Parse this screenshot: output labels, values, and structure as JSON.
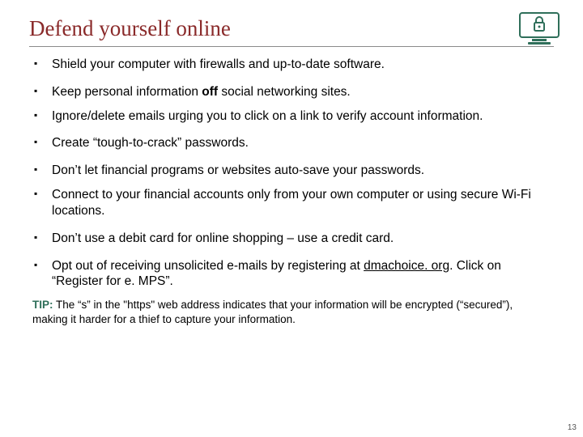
{
  "title": "Defend yourself online",
  "bullets": {
    "b1": "Shield your computer with firewalls and up-to-date software.",
    "b2_pre": "Keep personal information ",
    "b2_bold": "off",
    "b2_post": " social networking sites.",
    "b3": "Ignore/delete emails urging you to click on a link to verify account information.",
    "b4": "Create “tough-to-crack” passwords.",
    "b5": "Don’t let financial programs or websites auto-save your passwords.",
    "b6": "Connect to your financial accounts only from your own computer or using secure Wi-Fi locations.",
    "b7": "Don’t use a debit card for online shopping – use a credit card.",
    "b8_pre": "Opt out of receiving unsolicited e-mails by registering at ",
    "b8_link": "dmachoice. org",
    "b8_post": ". Click on “Register for e. MPS”."
  },
  "tip": {
    "label": "TIP:",
    "text": " The “s” in the \"https\" web address indicates that your information will be encrypted (“secured”), making it harder for a thief to capture your information."
  },
  "icon_name": "lock-monitor-icon",
  "page_number": "13"
}
